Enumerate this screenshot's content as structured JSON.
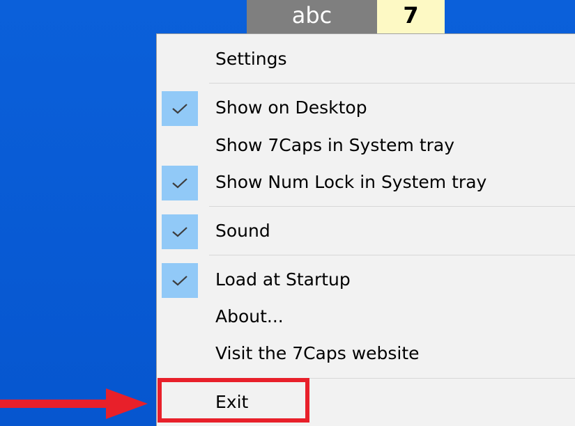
{
  "indicators": {
    "caps_text": "abc",
    "num_text": "7"
  },
  "menu": {
    "items": [
      {
        "label": "Settings",
        "checked": false
      },
      {
        "label": "Show on Desktop",
        "checked": true
      },
      {
        "label": "Show 7Caps in System tray",
        "checked": false
      },
      {
        "label": "Show Num Lock in System tray",
        "checked": true
      },
      {
        "label": "Sound",
        "checked": true
      },
      {
        "label": "Load at Startup",
        "checked": true
      },
      {
        "label": "About...",
        "checked": false
      },
      {
        "label": "Visit the 7Caps website",
        "checked": false
      },
      {
        "label": "Exit",
        "checked": false
      }
    ],
    "check_icon": "checkmark-icon"
  },
  "annotation": {
    "highlight_color": "#e8202a",
    "arrow_icon": "red-arrow-right-icon",
    "highlighted_item": "Exit"
  },
  "colors": {
    "desktop_bg": "#0a5fd8",
    "menu_bg": "#f2f2f2",
    "check_bg": "#91c9f7",
    "caps_indicator_bg": "#7f7f7f",
    "num_indicator_bg": "#fdf9c4"
  }
}
